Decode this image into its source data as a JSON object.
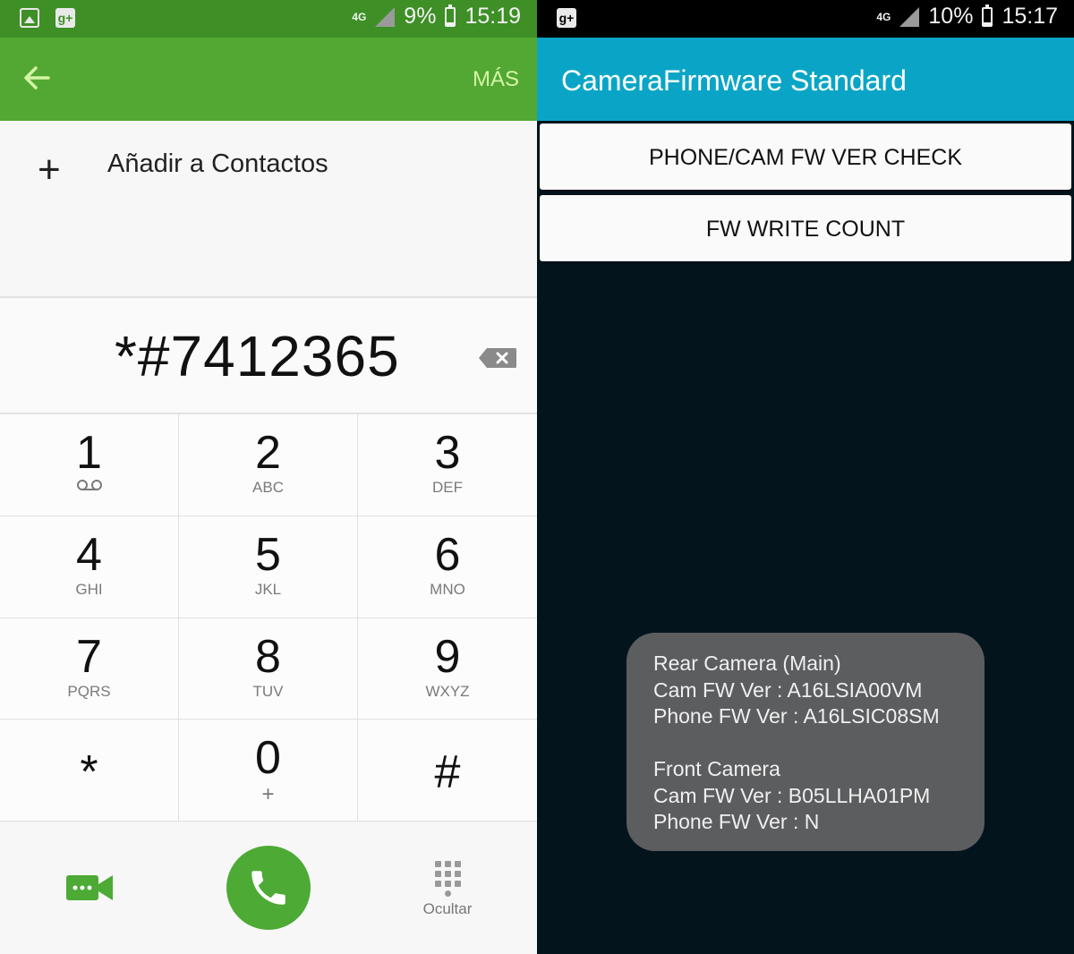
{
  "dialer": {
    "status_bar": {
      "network": "4G",
      "battery": "9%",
      "time": "15:19"
    },
    "app_bar": {
      "back_icon": "arrow-left-icon",
      "more_label": "MÁS",
      "accent_color": "#52a833"
    },
    "add_contact_label": "Añadir a Contactos",
    "number": "*#7412365",
    "keys": [
      {
        "digit": "1",
        "letters": ""
      },
      {
        "digit": "2",
        "letters": "ABC"
      },
      {
        "digit": "3",
        "letters": "DEF"
      },
      {
        "digit": "4",
        "letters": "GHI"
      },
      {
        "digit": "5",
        "letters": "JKL"
      },
      {
        "digit": "6",
        "letters": "MNO"
      },
      {
        "digit": "7",
        "letters": "PQRS"
      },
      {
        "digit": "8",
        "letters": "TUV"
      },
      {
        "digit": "9",
        "letters": "WXYZ"
      },
      {
        "digit": "*",
        "letters": ""
      },
      {
        "digit": "0",
        "letters": "+"
      },
      {
        "digit": "#",
        "letters": ""
      }
    ],
    "hide_label": "Ocultar"
  },
  "camera_app": {
    "status_bar": {
      "network": "4G",
      "battery": "10%",
      "time": "15:17"
    },
    "title": "CameraFirmware Standard",
    "header_color": "#0aa5c6",
    "buttons": {
      "ver_check": "PHONE/CAM FW VER CHECK",
      "write_count": "FW WRITE COUNT"
    },
    "toast": {
      "rear_title": "Rear Camera (Main)",
      "rear_cam": "Cam FW Ver : A16LSIA00VM",
      "rear_phone": "Phone FW Ver : A16LSIC08SM",
      "front_title": "Front Camera",
      "front_cam": "Cam FW Ver : B05LLHA01PM",
      "front_phone": "Phone FW Ver : N"
    }
  }
}
